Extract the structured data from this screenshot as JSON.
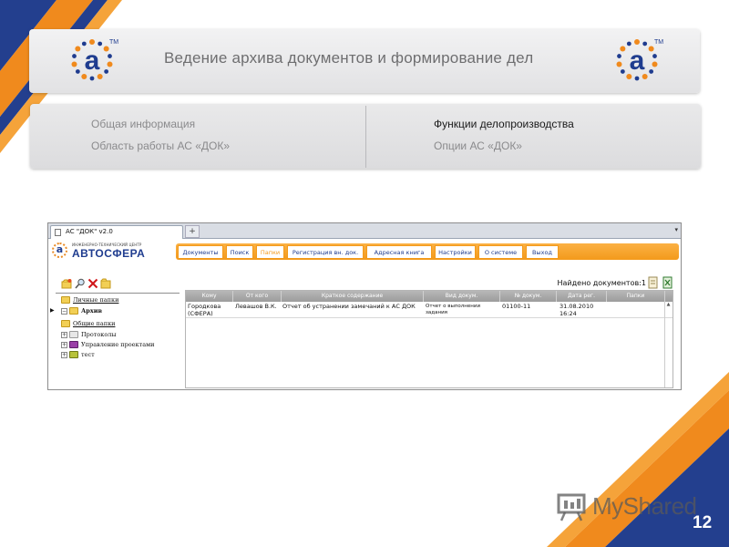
{
  "slide": {
    "title": "Ведение архива документов и формирование дел",
    "page_number": "12",
    "watermark": "MyShared"
  },
  "logo": {
    "letter": "a",
    "trademark": "TM"
  },
  "nav": {
    "left": [
      "Общая информация",
      "Область работы АС «ДОК»"
    ],
    "right": [
      "Функции делопроизводства",
      "Опции АС «ДОК»"
    ]
  },
  "browser": {
    "tab_title": "АС \"ДОК\" v2.0",
    "new_tab": "+"
  },
  "app": {
    "logo_tagline": "ИНЖЕНЕРНО-ТЕХНИЧЕСКИЙ ЦЕНТР",
    "logo_brand": "АВТОСФЕРА",
    "logo_letter": "a",
    "menu": [
      "Документы",
      "Поиск",
      "Папки",
      "Регистрация вн. док.",
      "Адресная книга",
      "Настройки",
      "О системе",
      "Выход"
    ],
    "active_menu": "Папки",
    "found_label": "Найдено документов:",
    "found_count": "1",
    "tree": {
      "personal": "Личные папки",
      "archive": "Архив",
      "shared": "Общие папки",
      "protocols": "Протоколы",
      "projects": "Управление проектами",
      "test": "тест"
    },
    "grid": {
      "headers": [
        "Кому",
        "От кого",
        "Краткое содержание",
        "Вид докум.",
        "№ докум.",
        "Дата рег.",
        "Папки"
      ],
      "rows": [
        {
          "to": "Городкова (СФЕРА)",
          "from": "Левашов В.К.",
          "summary": "Отчет об устранении замечаний к АС ДОК",
          "doc_type": "Отчет о выполнении задания",
          "doc_number": "01100-11",
          "reg_date": "31.08.2010 16:24",
          "folders": ""
        }
      ]
    }
  },
  "colors": {
    "orange": "#f39a1b",
    "navy": "#1f3c8f",
    "banner_text": "#6e6e70"
  }
}
